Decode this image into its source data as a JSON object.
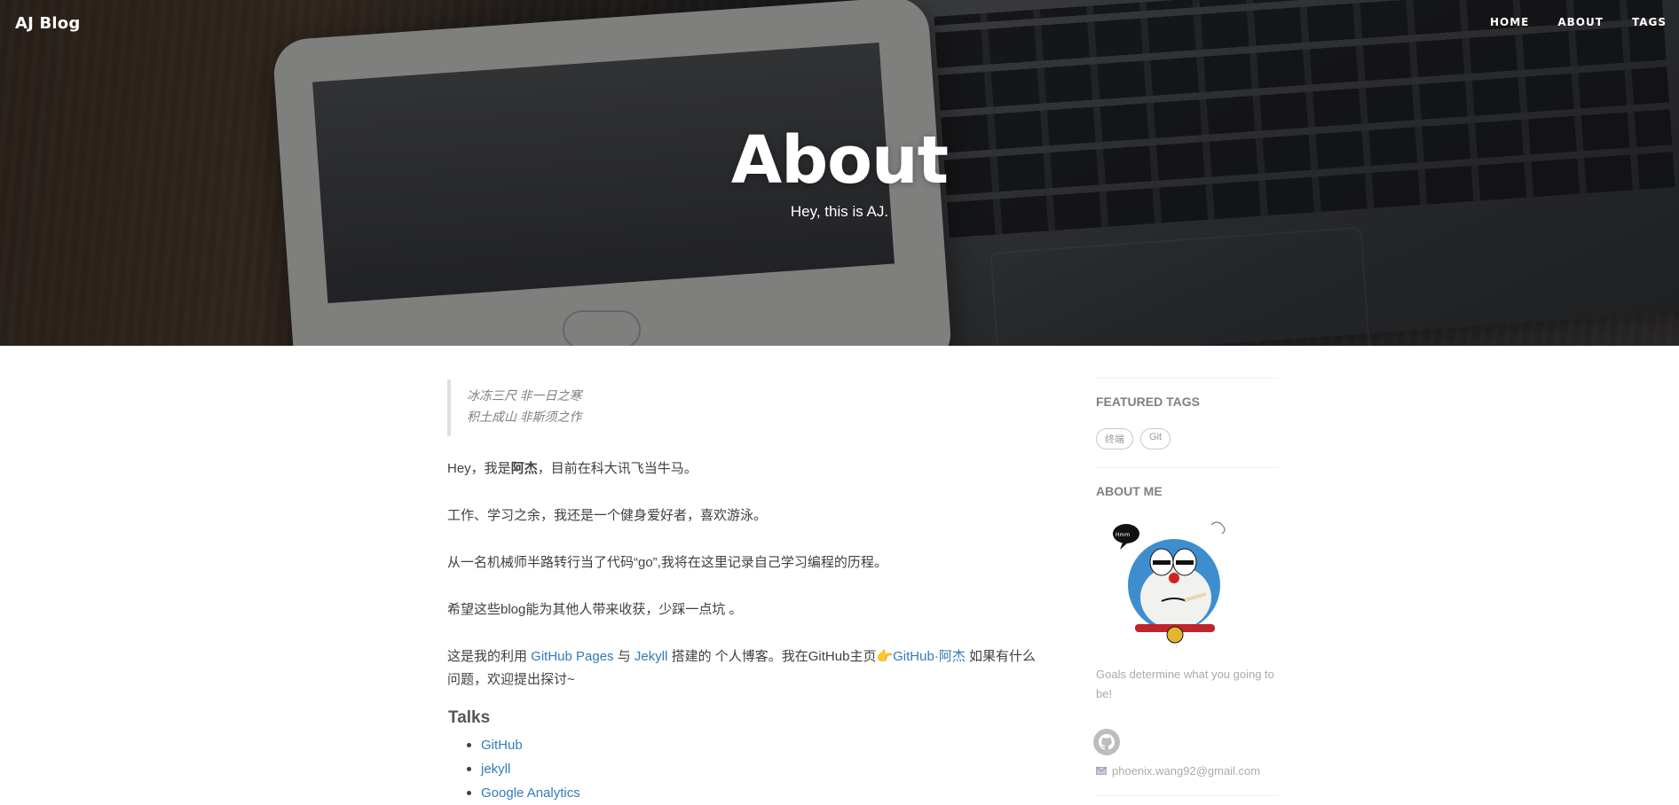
{
  "header": {
    "brand": "AJ Blog",
    "nav": [
      "HOME",
      "ABOUT",
      "TAGS"
    ],
    "title": "About",
    "subtitle": "Hey, this is AJ."
  },
  "main": {
    "quote_line1": "冰冻三尺 非一日之寒",
    "quote_line2": "积土成山 非斯须之作",
    "p1_a": "Hey，我是",
    "p1_b": "阿杰",
    "p1_c": "，目前在科大讯飞当牛马。",
    "p2": "工作、学习之余，我还是一个健身爱好者，喜欢游泳。",
    "p3": "从一名机械师半路转行当了代码“go”,我将在这里记录自己学习编程的历程。",
    "p4": "希望这些blog能为其他人带来收获，少踩一点坑 。",
    "p5_a": "这是我的利用 ",
    "p5_link1": "GitHub Pages",
    "p5_b": " 与 ",
    "p5_link2": "Jekyll",
    "p5_c": " 搭建的 个人博客。我在GitHub主页",
    "p5_hand": "👉",
    "p5_link3": "GitHub·阿杰",
    "p5_d": " 如果有什么问题，欢迎提出探讨~",
    "talks_title": "Talks",
    "talks": [
      "GitHub",
      "jekyll",
      "Google Analytics"
    ]
  },
  "sidebar": {
    "featured_title": "FEATURED TAGS",
    "tags": [
      "终端",
      "Git"
    ],
    "about_title": "ABOUT ME",
    "about_text": "Goals determine what you going to be!",
    "email": "phoenix.wang92@gmail.com"
  },
  "colors": {
    "link": "#337ab7",
    "hero_overlay": "rgba(0,0,0,0.45)"
  }
}
